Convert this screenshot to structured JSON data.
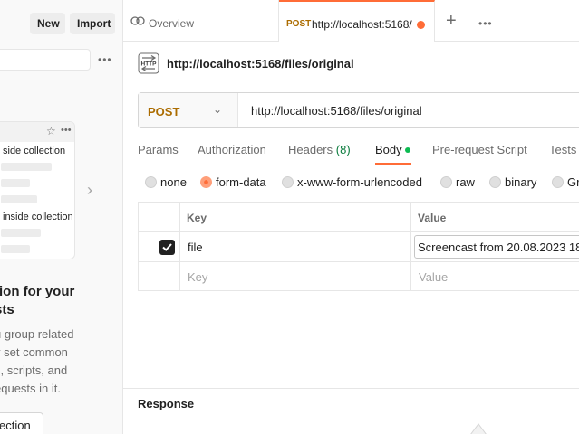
{
  "sidebar": {
    "new_label": "New",
    "import_label": "Import",
    "more_icon": "more-horizontal-icon",
    "card": {
      "star_icon": "star-icon",
      "more_icon": "more-horizontal-icon",
      "line1": "side collection",
      "line2": "inside collection"
    },
    "promo": {
      "title": "tion for your sts",
      "title_line1": "tion for your",
      "title_line2": "sts",
      "text_lines": [
        "u group related",
        "y set common",
        "s, scripts, and",
        "equests in it."
      ],
      "button_label": "ection"
    }
  },
  "tabs": {
    "overview_label": "Overview",
    "active": {
      "method": "POST",
      "url": "http://localhost:5168/",
      "unsaved_dot_color": "#ff6c37"
    },
    "plus_icon": "plus-icon",
    "more_icon": "more-horizontal-icon"
  },
  "request": {
    "icon": "http-icon",
    "title": "http://localhost:5168/files/original",
    "method": "POST",
    "url": "http://localhost:5168/files/original"
  },
  "request_tabs": [
    {
      "label": "Params"
    },
    {
      "label": "Authorization"
    },
    {
      "label": "Headers",
      "count": "(8)"
    },
    {
      "label": "Body"
    },
    {
      "label": "Pre-request Script"
    },
    {
      "label": "Tests"
    }
  ],
  "body_types": [
    "none",
    "form-data",
    "x-www-form-urlencoded",
    "raw",
    "binary",
    "Gr"
  ],
  "body_selected": "form-data",
  "form_table": {
    "headers": {
      "key": "Key",
      "value": "Value"
    },
    "rows": [
      {
        "checked": true,
        "key": "file",
        "value": "Screencast from 20.08.2023 18"
      }
    ],
    "placeholder": {
      "key": "Key",
      "value": "Value"
    }
  },
  "response": {
    "title": "Response"
  },
  "colors": {
    "accent": "#ff6c37",
    "method_post": "#ab6c00",
    "headers_count": "#0d7d3f",
    "body_dot": "#0cbb52"
  }
}
